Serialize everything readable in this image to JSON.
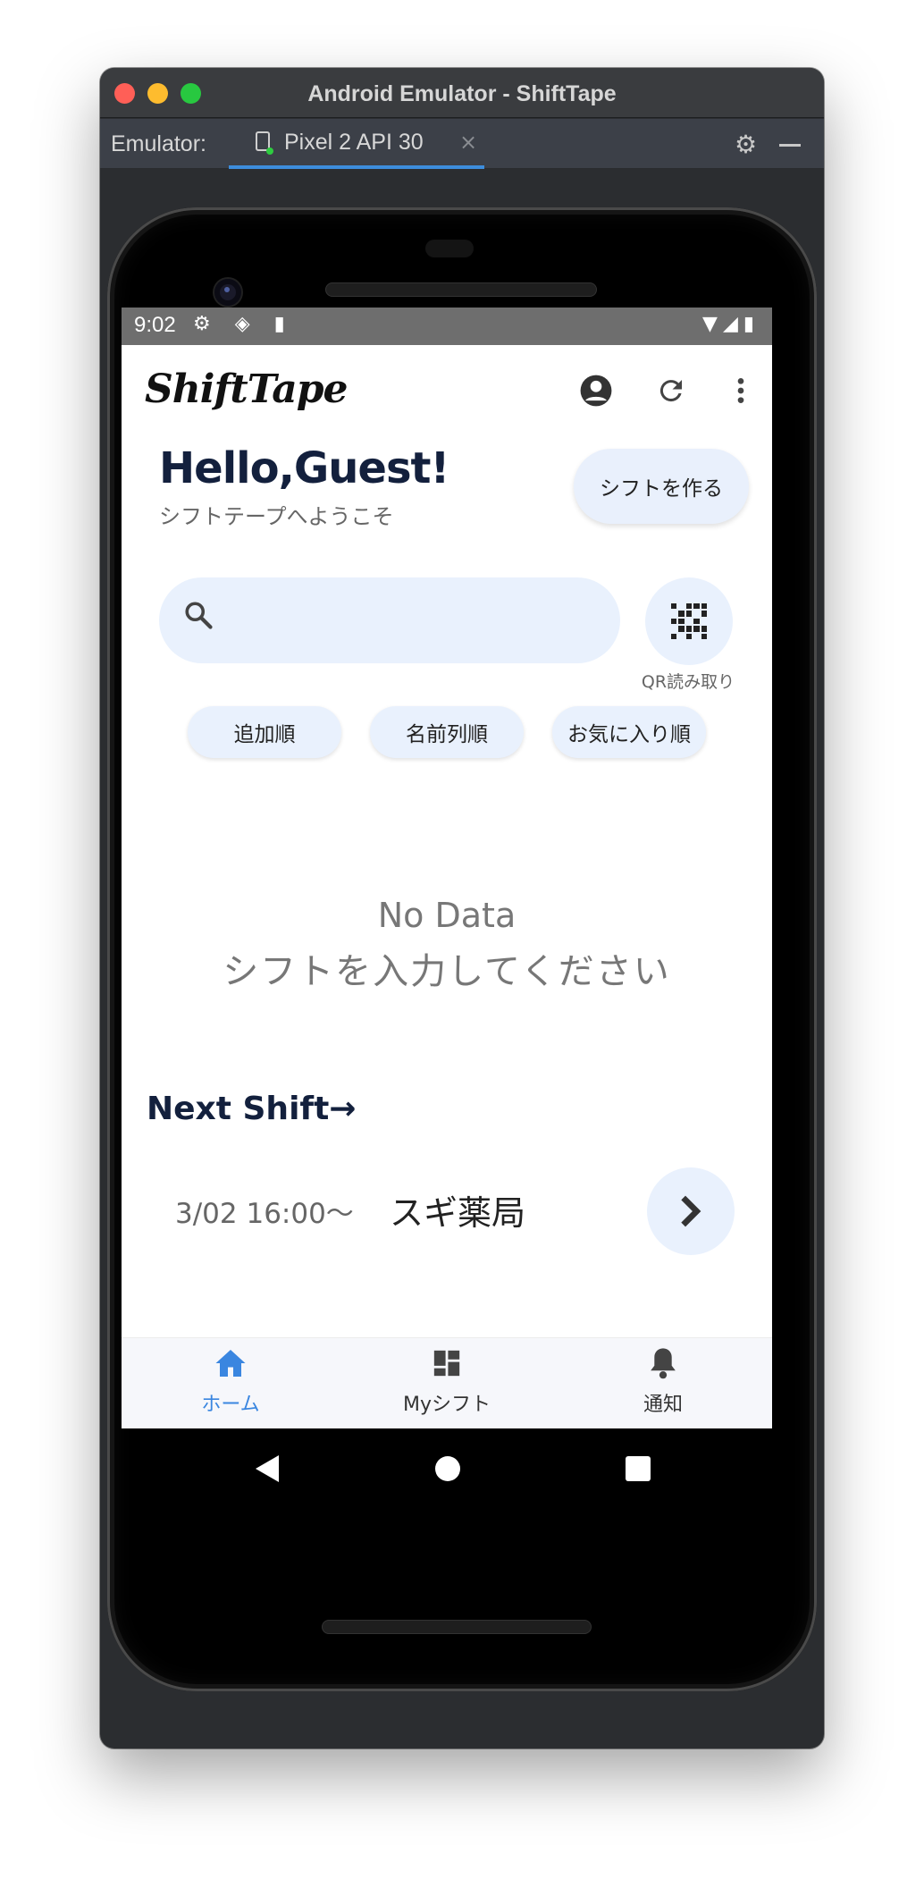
{
  "window": {
    "title": "Android Emulator - ShiftTape",
    "toolbar_label": "Emulator:",
    "device_tab": "Pixel 2 API 30",
    "tab_close": "×"
  },
  "status_bar": {
    "time": "9:02",
    "left_icons": "⚙ ◈ ▮",
    "right_icons": "▼◢▮"
  },
  "app": {
    "logo": "ShiftTape",
    "greeting_title": "Hello,Guest!",
    "greeting_subtitle": "シフトテープへようこそ",
    "create_shift_button": "シフトを作る",
    "search_placeholder": "",
    "qr_label": "QR読み取り",
    "sort_buttons": [
      "追加順",
      "名前列順",
      "お気に入り順"
    ],
    "empty_title": "No Data",
    "empty_message": "シフトを入力してください",
    "next_shift_title": "Next Shift→",
    "next_shift": {
      "time": "3/02 16:00〜",
      "place": "スギ薬局"
    },
    "bottom_nav": [
      {
        "label": "ホーム",
        "icon": "home-icon",
        "active": true
      },
      {
        "label": "Myシフト",
        "icon": "dashboard-icon",
        "active": false
      },
      {
        "label": "通知",
        "icon": "bell-icon",
        "active": false
      }
    ]
  },
  "colors": {
    "accent": "#3a86e0",
    "heading": "#13203d",
    "chip_bg": "#e9f1fd"
  }
}
